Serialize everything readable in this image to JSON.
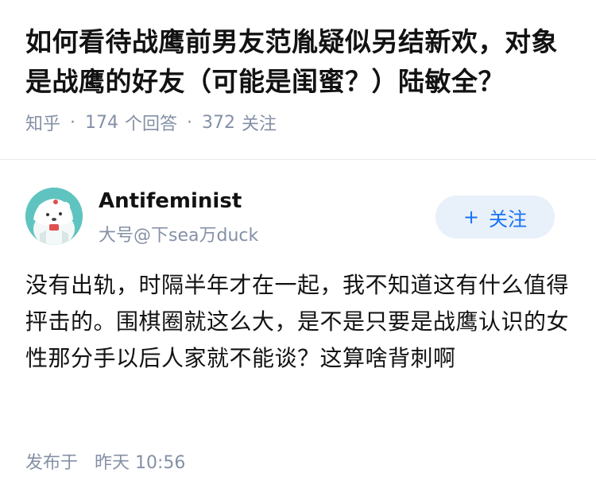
{
  "question": {
    "title": "如何看待战鹰前男友范胤疑似另结新欢，对象是战鹰的好友（可能是闺蜜？）陆敏全？",
    "source": "知乎",
    "answer_count": "174",
    "answer_label": "个回答",
    "follower_count": "372",
    "follower_label": "关注",
    "separator": "·"
  },
  "author": {
    "name": "Antifeminist",
    "bio": "大号@下sea万duck",
    "avatar_icon": "avatar-illustration",
    "follow_plus": "+",
    "follow_label": "关注"
  },
  "answer": {
    "content": "没有出轨，时隔半年才在一起，我不知道这有什么值得抨击的。围棋圈就这么大，是不是只要是战鹰认识的女性那分手以后人家就不能谈？这算啥背刺啊"
  },
  "publish": {
    "label": "发布于",
    "time": "昨天 10:56"
  },
  "colors": {
    "meta": "#8590a6",
    "accent": "#1772f6",
    "follow_bg": "#e8f0fa",
    "avatar_bg": "#5fc4c0"
  }
}
